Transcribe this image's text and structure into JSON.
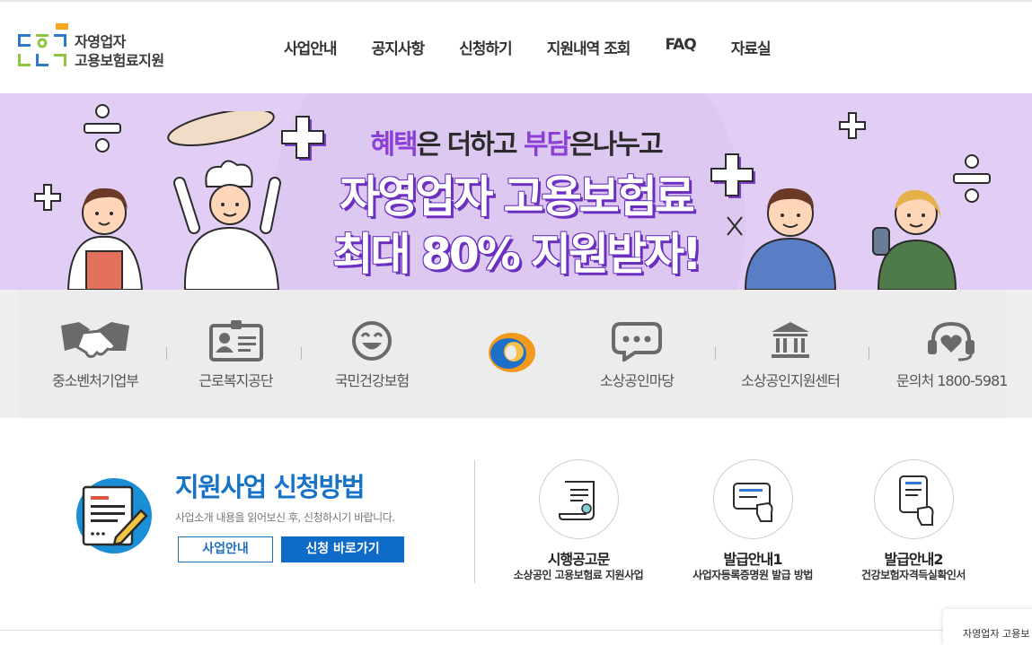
{
  "header": {
    "logo_line1": "자영업자",
    "logo_line2": "고용보험료지원",
    "nav": [
      "사업안내",
      "공지사항",
      "신청하기",
      "지원내역 조회",
      "FAQ",
      "자료실"
    ]
  },
  "banner": {
    "line1_hl1": "혜택",
    "line1_mid": "은 더하고 ",
    "line1_hl2": "부담",
    "line1_end": "은나누고",
    "line2": "자영업자 고용보험료",
    "line3": "최대 80% 지원받자!"
  },
  "quick_links": [
    {
      "label": "중소벤처기업부",
      "icon": "handshake-icon"
    },
    {
      "label": "근로복지공단",
      "icon": "id-card-icon"
    },
    {
      "label": "국민건강보험",
      "icon": "smile-icon"
    },
    {
      "label": "",
      "icon": "swirl-logo-icon"
    },
    {
      "label": "소상공인마당",
      "icon": "chat-bubble-icon"
    },
    {
      "label": "소상공인지원센터",
      "icon": "bank-building-icon"
    },
    {
      "label": "문의처 1800-5981",
      "icon": "headset-heart-icon"
    }
  ],
  "apply": {
    "title": "지원사업 신청방법",
    "subtitle": "사업소개 내용을 읽어보신 후, 신청하시기 바랍니다.",
    "btn_info": "사업안내",
    "btn_apply": "신청 바로가기"
  },
  "guides": [
    {
      "title": "시행공고문",
      "sub": "소상공인 고용보험료 지원사업",
      "icon": "scroll-certificate-icon"
    },
    {
      "title": "발급안내1",
      "sub": "사업자등록증명원 발급 방법",
      "icon": "hand-card-icon"
    },
    {
      "title": "발급안내2",
      "sub": "건강보험자격득실확인서",
      "icon": "hand-phone-document-icon"
    }
  ],
  "floating_tab": "자영업자 고용보",
  "colors": {
    "primary": "#1773c6",
    "banner_bg": "#e2cef5",
    "accent_purple": "#8c3fd6"
  }
}
